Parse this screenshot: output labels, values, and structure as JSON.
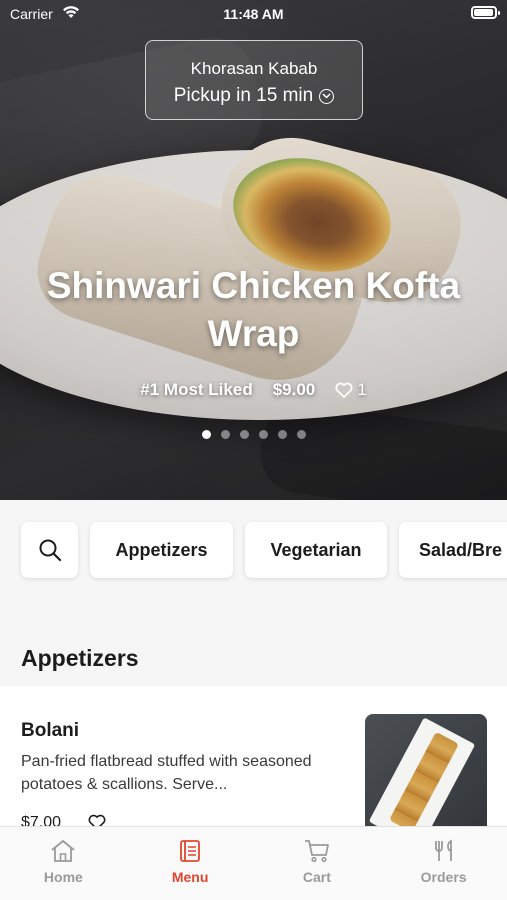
{
  "status_bar": {
    "carrier": "Carrier",
    "time": "11:48 AM"
  },
  "restaurant": {
    "name": "Khorasan Kabab",
    "pickup": "Pickup in 15 min"
  },
  "featured": {
    "title": "Shinwari Chicken Kofta Wrap",
    "badge": "#1 Most Liked",
    "price": "$9.00",
    "likes": "1",
    "carousel_pages": 6,
    "carousel_active": 1
  },
  "categories": [
    "Appetizers",
    "Vegetarian",
    "Salad/Bre"
  ],
  "section": {
    "title": "Appetizers"
  },
  "items": [
    {
      "title": "Bolani",
      "description": "Pan-fried flatbread stuffed with seasoned potatoes & scallions. Serve...",
      "price": "$7.00"
    }
  ],
  "tabs": [
    {
      "label": "Home",
      "icon": "home-icon",
      "active": false
    },
    {
      "label": "Menu",
      "icon": "menu-icon",
      "active": true
    },
    {
      "label": "Cart",
      "icon": "cart-icon",
      "active": false
    },
    {
      "label": "Orders",
      "icon": "orders-icon",
      "active": false
    }
  ],
  "colors": {
    "accent": "#e2452f",
    "inactive": "#9a9a9a"
  }
}
